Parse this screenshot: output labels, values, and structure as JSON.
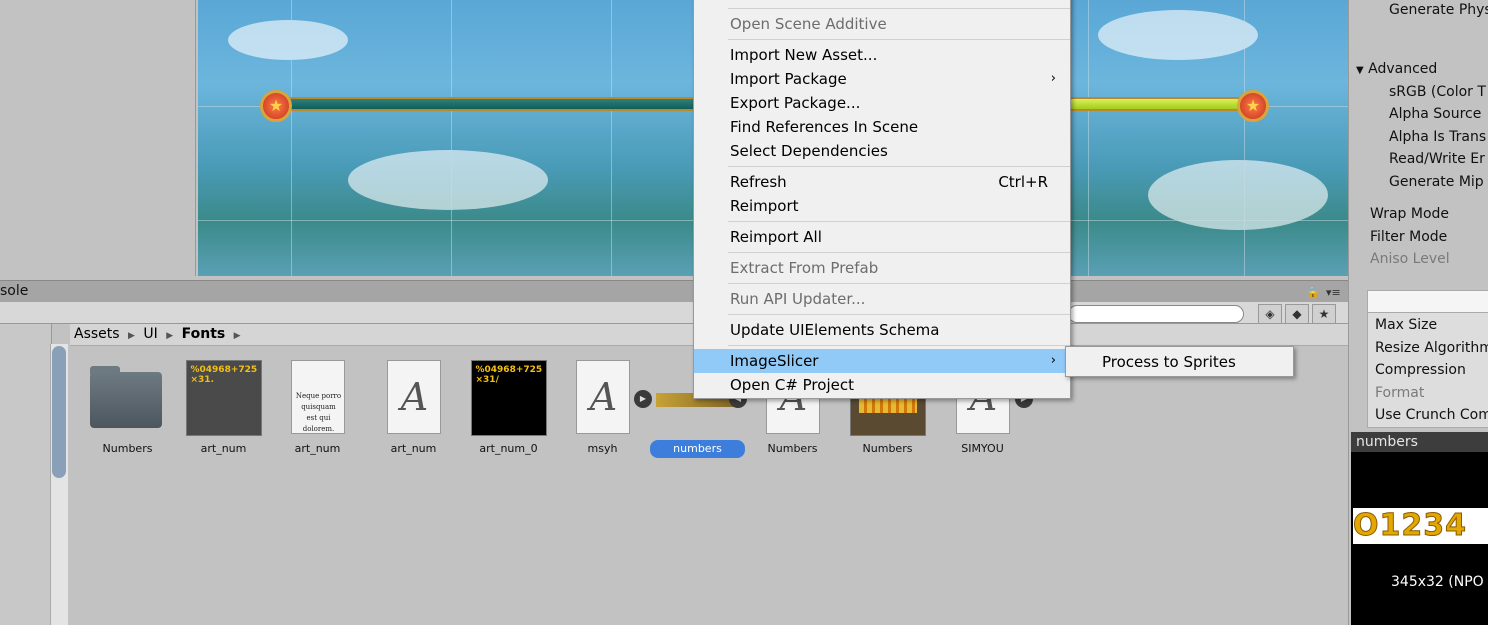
{
  "console_tab": "sole",
  "breadcrumb": [
    "Assets",
    "UI",
    "Fonts"
  ],
  "assets": [
    {
      "label": "Numbers",
      "kind": "folder"
    },
    {
      "label": "art_num",
      "kind": "texture-dark",
      "preview_text": "%04968+725\n×31."
    },
    {
      "label": "art_num",
      "kind": "text-doc",
      "preview_text": "Neque porro quisquam est qui dolorem."
    },
    {
      "label": "art_num",
      "kind": "font"
    },
    {
      "label": "art_num_0",
      "kind": "texture-black",
      "preview_text": "%04968+725\n×31/"
    },
    {
      "label": "msyh",
      "kind": "font"
    },
    {
      "label": "numbers",
      "kind": "sprite-strip",
      "selected": true
    },
    {
      "label": "Numbers",
      "kind": "font"
    },
    {
      "label": "Numbers",
      "kind": "texture-fire"
    },
    {
      "label": "SIMYOU",
      "kind": "font"
    }
  ],
  "context_menu": {
    "items": [
      {
        "label": "Open Scene Additive",
        "disabled": true
      },
      {
        "label": "Import New Asset..."
      },
      {
        "label": "Import Package",
        "submenu": true
      },
      {
        "label": "Export Package..."
      },
      {
        "label": "Find References In Scene"
      },
      {
        "label": "Select Dependencies"
      },
      {
        "label": "Refresh",
        "shortcut": "Ctrl+R"
      },
      {
        "label": "Reimport"
      },
      {
        "label": "Reimport All"
      },
      {
        "label": "Extract From Prefab",
        "disabled": true
      },
      {
        "label": "Run API Updater...",
        "disabled": true
      },
      {
        "label": "Update UIElements Schema"
      },
      {
        "label": "ImageSlicer",
        "submenu": true,
        "highlighted": true
      },
      {
        "label": "Open C# Project"
      }
    ],
    "submenu_item": "Process to Sprites"
  },
  "inspector": {
    "generate_physics": "Generate Phys",
    "advanced": "Advanced",
    "srgb": "sRGB (Color T",
    "alpha_source": "Alpha Source",
    "alpha_is_trans": "Alpha Is Trans",
    "read_write": "Read/Write Er",
    "generate_mip": "Generate Mip I",
    "wrap_mode": "Wrap Mode",
    "filter_mode": "Filter Mode",
    "aniso_level": "Aniso Level",
    "max_size": "Max Size",
    "resize_algorithm": "Resize Algorithm",
    "compression": "Compression",
    "format": "Format",
    "use_crunch": "Use Crunch Com",
    "preview_title": "numbers",
    "preview_digits": "O1234",
    "preview_size": "345x32 (NPO"
  },
  "colors": {
    "menu_highlight": "#91c9f7",
    "selection": "#3d7edc",
    "panel": "#c2c2c2"
  }
}
